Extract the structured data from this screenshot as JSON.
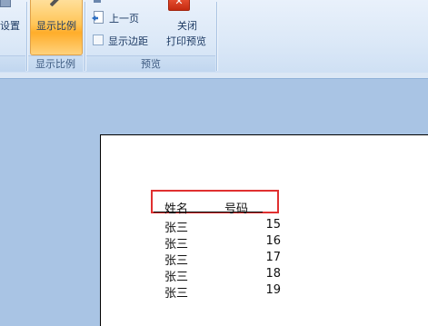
{
  "ribbon": {
    "setup_label": "设置",
    "zoom_button_label": "显示比例",
    "zoom_group_label": "显示比例",
    "prev_page_label": "上一页",
    "show_margins_label": "显示边距",
    "show_margins_checked": false,
    "close_label_1": "关闭",
    "close_label_2": "打印预览",
    "preview_group_label": "预览"
  },
  "sheet": {
    "header": {
      "name": "姓名",
      "number": "号码"
    },
    "rows": [
      {
        "name": "张三",
        "number": "15"
      },
      {
        "name": "张三",
        "number": "16"
      },
      {
        "name": "张三",
        "number": "17"
      },
      {
        "name": "张三",
        "number": "18"
      },
      {
        "name": "张三",
        "number": "19"
      }
    ]
  },
  "colors": {
    "highlight": "#e03030",
    "ribbon_bg": "#dbe8f7",
    "workspace_bg": "#a9c4e4"
  }
}
